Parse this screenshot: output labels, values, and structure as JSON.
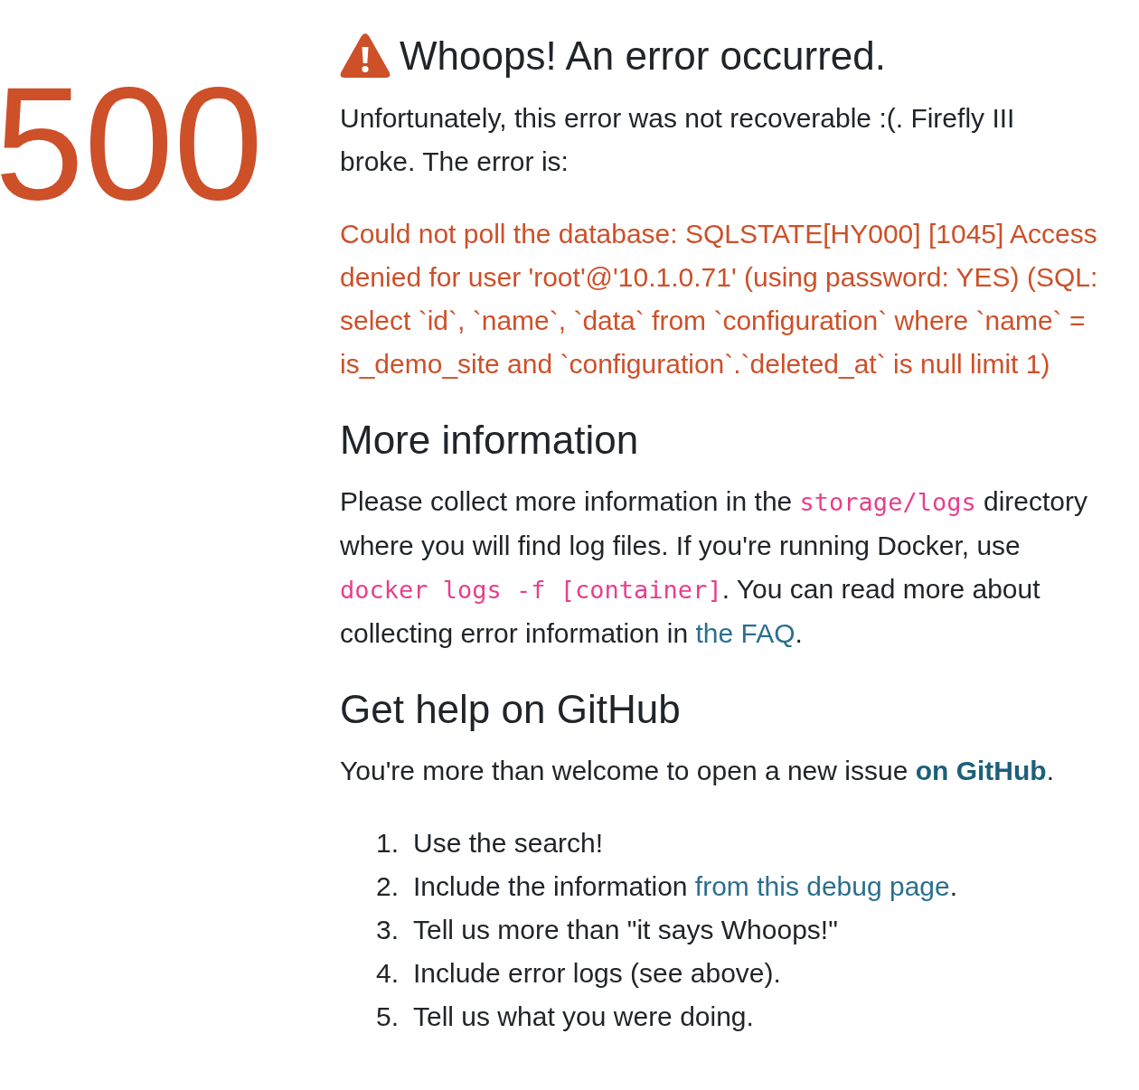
{
  "status_code": "500",
  "heading": {
    "title": "Whoops! An error occurred."
  },
  "intro": "Unfortunately, this error was not recoverable :(. Firefly III broke. The error is:",
  "error_message": "Could not poll the database: SQLSTATE[HY000] [1045] Access denied for user 'root'@'10.1.0.71' (using password: YES) (SQL: select `id`, `name`, `data` from `configuration` where `name` = is_demo_site and `configuration`.`deleted_at` is null limit 1)",
  "sections": [
    {
      "title": "More information",
      "paragraph": [
        {
          "kind": "text",
          "text": "Please collect more information in the "
        },
        {
          "kind": "code",
          "text": "storage/logs"
        },
        {
          "kind": "text",
          "text": " directory where you will find log files. If you're running Docker, use "
        },
        {
          "kind": "code",
          "text": "docker logs -f [container]"
        },
        {
          "kind": "text",
          "text": ". You can read more about collecting error information in "
        },
        {
          "kind": "link",
          "text": "the FAQ",
          "bold": false
        },
        {
          "kind": "text",
          "text": "."
        }
      ]
    },
    {
      "title": "Get help on GitHub",
      "paragraph": [
        {
          "kind": "text",
          "text": "You're more than welcome to open a new issue "
        },
        {
          "kind": "link",
          "text": "on GitHub",
          "bold": true
        },
        {
          "kind": "text",
          "text": "."
        }
      ],
      "steps": [
        {
          "number": "1.",
          "parts": [
            {
              "kind": "text",
              "text": "Use the search!"
            }
          ]
        },
        {
          "number": "2.",
          "parts": [
            {
              "kind": "text",
              "text": "Include the information "
            },
            {
              "kind": "link",
              "text": "from this debug page",
              "bold": false
            },
            {
              "kind": "text",
              "text": "."
            }
          ]
        },
        {
          "number": "3.",
          "parts": [
            {
              "kind": "text",
              "text": "Tell us more than \"it says Whoops!\""
            }
          ]
        },
        {
          "number": "4.",
          "parts": [
            {
              "kind": "text",
              "text": "Include error logs (see above)."
            }
          ]
        },
        {
          "number": "5.",
          "parts": [
            {
              "kind": "text",
              "text": "Tell us what you were doing."
            }
          ]
        }
      ]
    }
  ]
}
